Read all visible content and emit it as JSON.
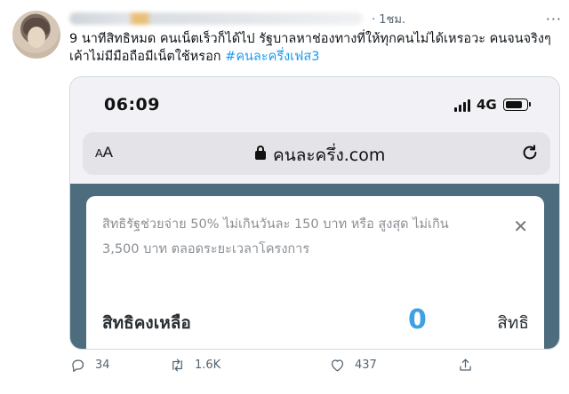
{
  "tweet": {
    "time": "· 1ชม.",
    "body": "9 นาทีสิทธิหมด คนเน็ตเร็วก็ได้ไป รัฐบาลหาช่องทางที่ให้ทุกคนไม่ได้เหรอวะ คนจนจริงๆเค้าไม่มีมือถือมีเน็ตใช้หรอก ",
    "hashtag": "#คนละครึ่งเฟส3",
    "more_icon": "more-dots-icon"
  },
  "screenshot": {
    "clock": "06:09",
    "network": "4G",
    "url_bar": {
      "aa_small": "A",
      "aa_large": "A",
      "url": "คนละครึ่ง.com"
    },
    "card": {
      "description": "สิทธิรัฐช่วยจ่าย 50% ไม่เกินวันละ 150 บาท หรือ สูงสุด ไม่เกิน 3,500 บาท ตลอดระยะเวลาโครงการ",
      "close": "✕",
      "remaining_label": "สิทธิคงเหลือ",
      "remaining_value": "0",
      "remaining_unit": "สิทธิ"
    },
    "colors": {
      "app_background": "#4d6c7e",
      "value_accent": "#3fa0e3"
    }
  },
  "actions": {
    "reply_count": "34",
    "retweet_count": "1.6K",
    "like_count": "437"
  }
}
